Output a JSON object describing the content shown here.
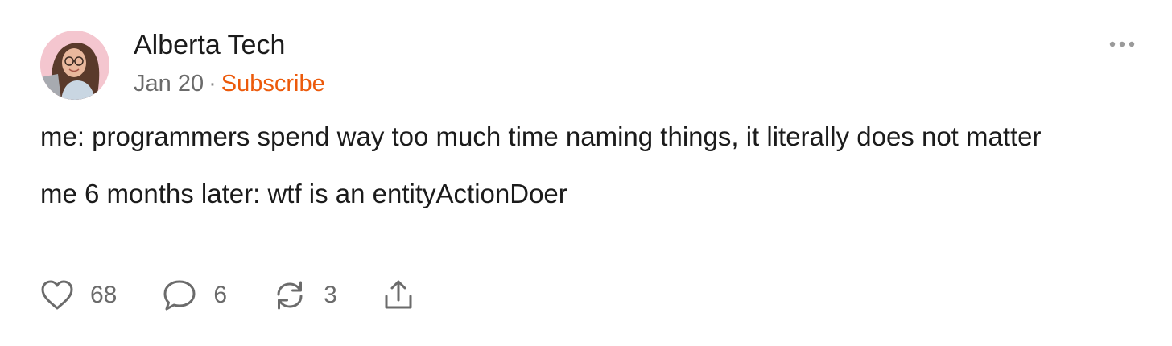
{
  "post": {
    "author": "Alberta Tech",
    "date": "Jan 20",
    "separator": "·",
    "subscribe_label": "Subscribe",
    "paragraphs": [
      "me: programmers spend way too much time naming things, it literally does not matter",
      "me 6 months later: wtf is an entityActionDoer"
    ]
  },
  "actions": {
    "likes": "68",
    "comments": "6",
    "restacks": "3"
  },
  "icons": {
    "more": "ellipsis-icon",
    "like": "heart-icon",
    "comment": "speech-bubble-icon",
    "restack": "refresh-arrows-icon",
    "share": "share-upload-icon"
  },
  "colors": {
    "accent": "#ec5a0b",
    "text": "#1b1b1b",
    "muted": "#6b6b6b"
  }
}
